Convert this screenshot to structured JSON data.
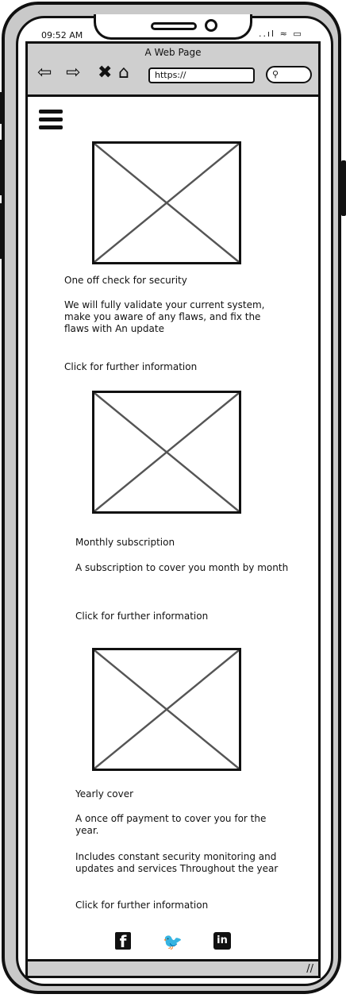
{
  "status": {
    "time": "09:52 AM",
    "icons": "..ıl ≈ ▭"
  },
  "browser": {
    "title": "A Web Page",
    "back_icon": "⇦",
    "forward_icon": "⇨",
    "close_icon": "✖",
    "home_icon": "⌂",
    "url": "https://",
    "search_icon": "⚲"
  },
  "cards": [
    {
      "title": "One off check for security",
      "description": "We will fully validate your current system, make you aware of any flaws, and fix the flaws with An update",
      "link": "Click for further information"
    },
    {
      "title": "Monthly subscription",
      "description": "A subscription to cover you month by month",
      "link": "Click for further information"
    },
    {
      "title": "Yearly cover",
      "description": "A once off payment to cover you for the year.",
      "extra": "Includes constant security monitoring and updates and services Throughout the year",
      "link": "Click for further information"
    }
  ],
  "social": {
    "facebook": "f",
    "twitter": "🐦",
    "linkedin": "in"
  },
  "resize_glyph": "//"
}
